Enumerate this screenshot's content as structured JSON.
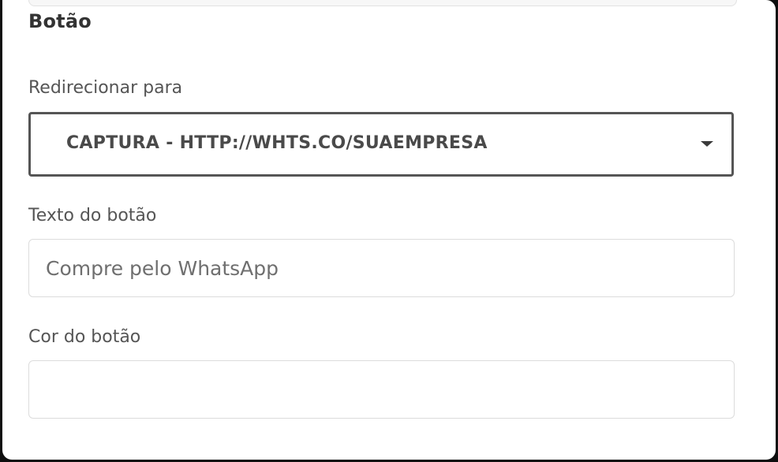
{
  "section": {
    "title": "Botão"
  },
  "redirect": {
    "label": "Redirecionar para",
    "selected": "CAPTURA - HTTP://WHTS.CO/SUAEMPRESA"
  },
  "button_text": {
    "label": "Texto do botão",
    "value": "",
    "placeholder": "Compre pelo WhatsApp"
  },
  "button_color": {
    "label": "Cor do botão",
    "value": ""
  },
  "icons": {
    "dropdown": "caret-down-icon"
  },
  "colors": {
    "panel_background": "#ffffff",
    "outer_background": "#0e0e0e",
    "select_border": "#555555",
    "input_border": "#dcdcdc",
    "title_text": "#333333"
  }
}
